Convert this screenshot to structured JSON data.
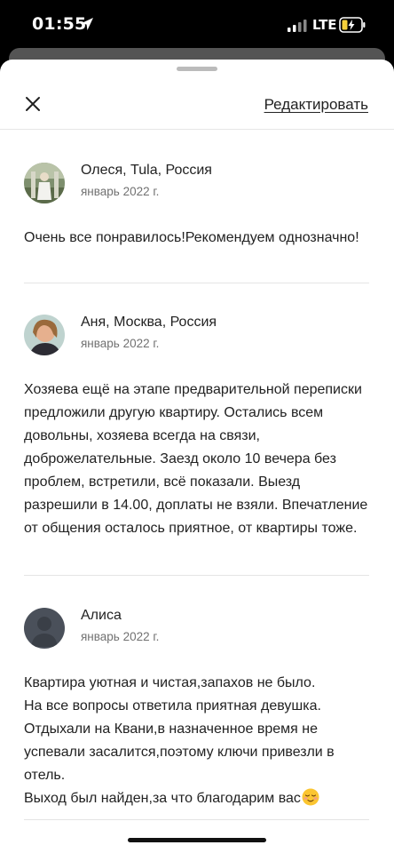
{
  "status_bar": {
    "time": "01:55",
    "network": "LTE",
    "location_icon": "location-arrow-icon",
    "signal_icon": "signal-bars-icon",
    "battery_icon": "battery-charging-icon"
  },
  "header": {
    "close_icon": "close-icon",
    "edit_label": "Редактировать"
  },
  "reviews": [
    {
      "author": "Олеся, Tula, Россия",
      "date": "январь 2022 г.",
      "text": "Очень все понравилось!Рекомендуем однозначно!",
      "avatar_icon": "user-photo-avatar"
    },
    {
      "author": "Аня, Москва, Россия",
      "date": "январь 2022 г.",
      "text": "Хозяева ещё на этапе предварительной переписки предложили другую квартиру. Остались всем довольны, хозяева всегда на связи, доброжелательные. Заезд около 10 вечера без проблем, встретили, всё показали. Выезд разрешили в 14.00, доплаты не взяли. Впечатление от общения осталось приятное, от квартиры тоже.",
      "avatar_icon": "user-photo-avatar"
    },
    {
      "author": "Алиса",
      "date": "январь 2022 г.",
      "text": "Квартира уютная и чистая,запахов не было.\nНа все вопросы ответила приятная девушка.\nОтдыхали на Квани,в назначенное время не успевали засалится,поэтому ключи привезли в отель.\nВыход был найден,за что благодарим вас",
      "emoji_icon": "smiling-face-emoji-icon",
      "avatar_icon": "default-user-avatar"
    }
  ],
  "colors": {
    "text": "#222222",
    "secondary_text": "#717171",
    "divider": "#e4e4e4",
    "battery_charging": "#f5d03b"
  }
}
